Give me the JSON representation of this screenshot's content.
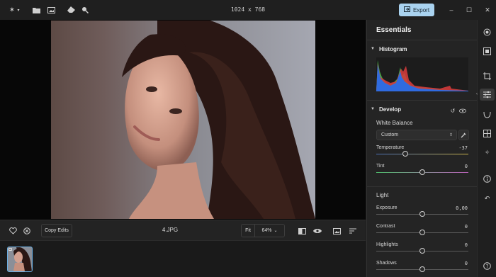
{
  "titlebar": {
    "app_icon": "sparkle-icon",
    "dimensions": "1024 x 768",
    "export_label": "Export",
    "icons": [
      "folder-icon",
      "image-icon",
      "eraser-icon",
      "search-icon"
    ],
    "window_controls": [
      "minimize-icon",
      "maximize-icon",
      "close-icon"
    ]
  },
  "bottombar": {
    "copy_edits_label": "Copy Edits",
    "filename": "4.JPG",
    "fit_label": "Fit",
    "zoom_value": "64%",
    "zoom_caret": "⌄"
  },
  "panel": {
    "title": "Essentials",
    "histogram_title": "Histogram",
    "develop_title": "Develop",
    "white_balance_label": "White Balance",
    "white_balance_value": "Custom",
    "sliders": [
      {
        "label": "Temperature",
        "value": "-37",
        "display": -37,
        "min": -100,
        "max": 100
      },
      {
        "label": "Tint",
        "value": "0",
        "display": 0,
        "min": -100,
        "max": 100
      }
    ],
    "light_title": "Light",
    "light_sliders": [
      {
        "label": "Exposure",
        "value": "0,00",
        "display": 0,
        "min": -5,
        "max": 5
      },
      {
        "label": "Contrast",
        "value": "0",
        "display": 0,
        "min": -100,
        "max": 100
      },
      {
        "label": "Highlights",
        "value": "0",
        "display": 0,
        "min": -100,
        "max": 100
      },
      {
        "label": "Shadows",
        "value": "0",
        "display": 0,
        "min": -100,
        "max": 100
      }
    ]
  },
  "colors": {
    "accent": "#a9d2ef",
    "hist_blue": "#2f6be0",
    "hist_red": "#d23b3b",
    "hist_green": "#3fc24a"
  }
}
